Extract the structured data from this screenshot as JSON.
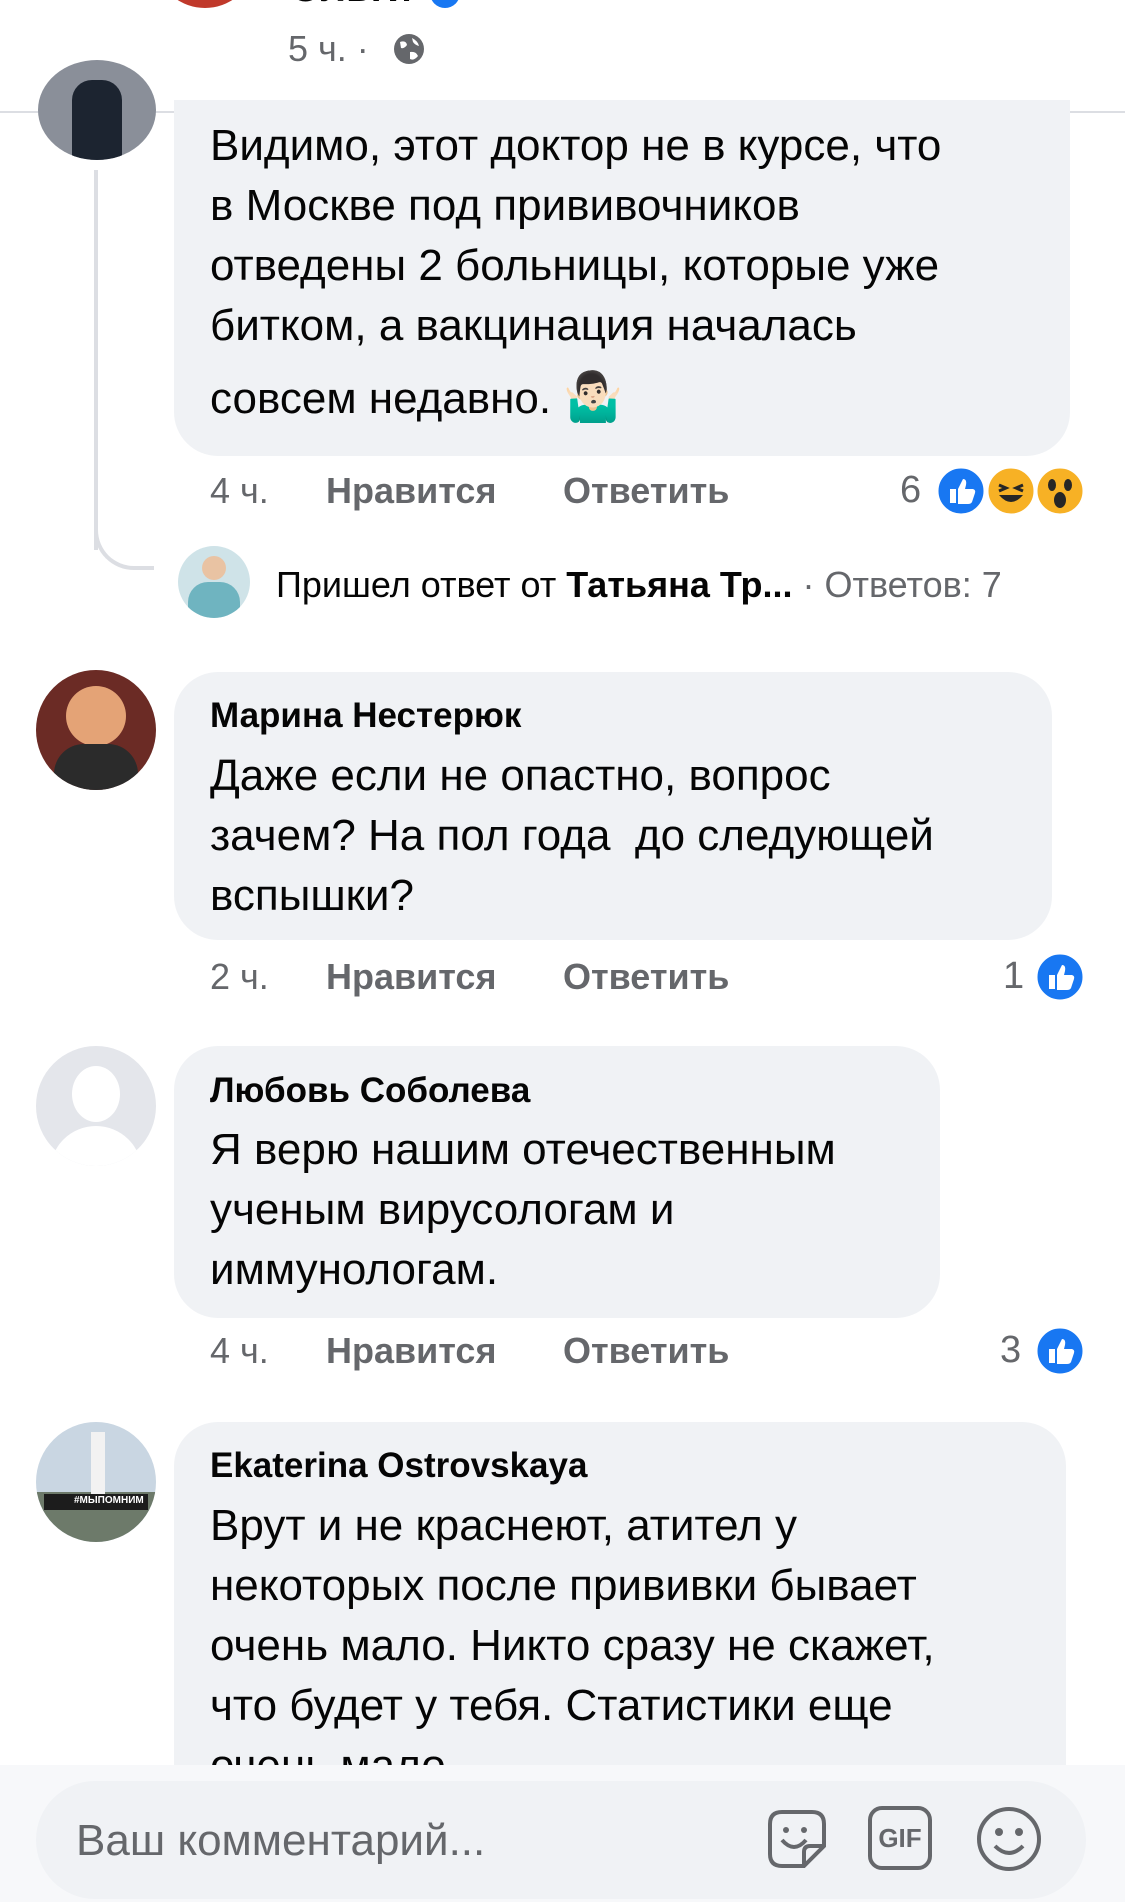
{
  "post": {
    "author_visible": "Ольги",
    "time": "5 ч. ·",
    "privacy_icon": "globe-icon"
  },
  "reply": {
    "text_lines": [
      "Видимо, этот доктор не в курсе, что",
      "в Москве под прививочников",
      "отведены 2 больницы, которые уже",
      "битком, а вакцинация началась",
      "совсем недавно."
    ],
    "emoji": "🤷🏻‍♂️",
    "time": "4 ч.",
    "like_label": "Нравится",
    "reply_label": "Ответить",
    "reaction_count": "6",
    "reactions": [
      "like-icon",
      "haha-icon",
      "wow-icon"
    ]
  },
  "replies_summary": {
    "prefix": "Пришел ответ от ",
    "author": "Татьяна Тр...",
    "suffix": " · Ответов: 7"
  },
  "comments": [
    {
      "author": "Марина Нестерюк",
      "lines": [
        "Даже если не опастно, вопрос",
        "зачем? На пол года  до следующей",
        "вспышки?"
      ],
      "time": "2 ч.",
      "like_label": "Нравится",
      "reply_label": "Ответить",
      "reaction_count": "1"
    },
    {
      "author": "Любовь Соболева",
      "lines": [
        "Я верю нашим отечественным",
        "ученым вирусологам и",
        "иммунологам."
      ],
      "time": "4 ч.",
      "like_label": "Нравится",
      "reply_label": "Ответить",
      "reaction_count": "3"
    },
    {
      "author": "Ekaterina Ostrovskaya",
      "lines": [
        "Врут и не краснеют, атител у",
        "некоторых после прививки бывает",
        "очень мало. Никто сразу не скажет,",
        "что будет у тебя. Статистики еще",
        "очень мало."
      ],
      "avatar_caption": "#МЫПОМНИМ"
    }
  ],
  "composer": {
    "placeholder": "Ваш комментарий...",
    "gif_label": "GIF",
    "icons": [
      "sticker-icon",
      "gif-icon",
      "emoji-icon"
    ]
  },
  "colors": {
    "like_blue": "#1877f2",
    "bubble_gray": "#f0f2f5",
    "secondary_text": "#65676b"
  }
}
